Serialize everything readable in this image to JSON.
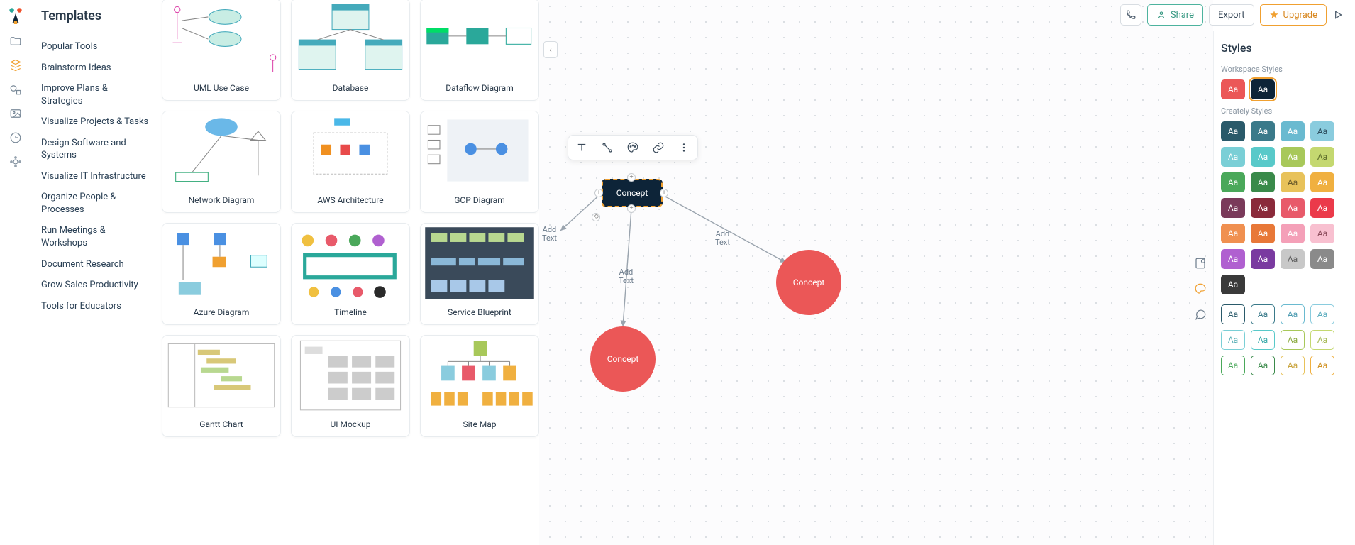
{
  "sidebar": {
    "title": "Templates",
    "categories": [
      "Popular Tools",
      "Brainstorm Ideas",
      "Improve Plans & Strategies",
      "Visualize Projects & Tasks",
      "Design Software and Systems",
      "Visualize IT Infrastructure",
      "Organize People & Processes",
      "Run Meetings & Workshops",
      "Document Research",
      "Grow Sales Productivity",
      "Tools for Educators"
    ]
  },
  "templates": [
    {
      "label": "UML Use Case"
    },
    {
      "label": "Database"
    },
    {
      "label": "Dataflow Diagram"
    },
    {
      "label": "Network Diagram"
    },
    {
      "label": "AWS Architecture"
    },
    {
      "label": "GCP Diagram"
    },
    {
      "label": "Azure Diagram"
    },
    {
      "label": "Timeline"
    },
    {
      "label": "Service Blueprint"
    },
    {
      "label": "Gantt Chart"
    },
    {
      "label": "UI Mockup"
    },
    {
      "label": "Site Map"
    }
  ],
  "canvas": {
    "collapse_glyph": "‹",
    "nodes": {
      "main": "Concept",
      "c1": "Concept",
      "c2": "Concept"
    },
    "hints": {
      "left": "Add\nText",
      "mid": "Add\nText",
      "right": "Add\nText"
    }
  },
  "styles_panel": {
    "title": "Styles",
    "group_workspace": "Workspace Styles",
    "group_creately": "Creately Styles",
    "swatch_label": "Aa",
    "workspace": [
      {
        "bg": "#eb5757",
        "fg": "#ffffff",
        "selected": false
      },
      {
        "bg": "#0d2438",
        "fg": "#ffffff",
        "selected": true
      }
    ],
    "creately_solid": [
      {
        "bg": "#2a5a6a",
        "fg": "#ffffff"
      },
      {
        "bg": "#3a7a8a",
        "fg": "#ffffff"
      },
      {
        "bg": "#6abad0",
        "fg": "#ffffff"
      },
      {
        "bg": "#8accde",
        "fg": "#2a4a5a"
      },
      {
        "bg": "#7acfd6",
        "fg": "#ffffff"
      },
      {
        "bg": "#58c9c9",
        "fg": "#ffffff"
      },
      {
        "bg": "#a8c85a",
        "fg": "#ffffff"
      },
      {
        "bg": "#c4d870",
        "fg": "#5a6a2a"
      },
      {
        "bg": "#4aa85a",
        "fg": "#ffffff"
      },
      {
        "bg": "#3a8a4a",
        "fg": "#ffffff"
      },
      {
        "bg": "#e8c25a",
        "fg": "#6a5a2a"
      },
      {
        "bg": "#f0b040",
        "fg": "#ffffff"
      },
      {
        "bg": "#7a3a5a",
        "fg": "#ffffff"
      },
      {
        "bg": "#8a2a3a",
        "fg": "#ffffff"
      },
      {
        "bg": "#e85a6a",
        "fg": "#ffffff"
      },
      {
        "bg": "#eb3a4a",
        "fg": "#ffffff"
      },
      {
        "bg": "#f09050",
        "fg": "#ffffff"
      },
      {
        "bg": "#e87838",
        "fg": "#ffffff"
      },
      {
        "bg": "#f4a0b8",
        "fg": "#ffffff"
      },
      {
        "bg": "#f8c0d0",
        "fg": "#8a4a5a"
      },
      {
        "bg": "#b060d0",
        "fg": "#ffffff"
      },
      {
        "bg": "#7a3aa0",
        "fg": "#ffffff"
      },
      {
        "bg": "#c8c8c8",
        "fg": "#5a5a5a"
      },
      {
        "bg": "#8a8a8a",
        "fg": "#ffffff"
      },
      {
        "bg": "#3a3a3a",
        "fg": "#ffffff"
      }
    ],
    "creately_outline": [
      {
        "border": "#2a5a6a",
        "fg": "#2a5a6a"
      },
      {
        "border": "#3a7a8a",
        "fg": "#3a7a8a"
      },
      {
        "border": "#6abad0",
        "fg": "#4a9ab0"
      },
      {
        "border": "#8accde",
        "fg": "#5aacbe"
      },
      {
        "border": "#7acfd6",
        "fg": "#5aafb6"
      },
      {
        "border": "#58c9c9",
        "fg": "#38a9a9"
      },
      {
        "border": "#a8c85a",
        "fg": "#88a83a"
      },
      {
        "border": "#c4d870",
        "fg": "#a4b850"
      },
      {
        "border": "#4aa85a",
        "fg": "#4aa85a"
      },
      {
        "border": "#3a8a4a",
        "fg": "#3a8a4a"
      },
      {
        "border": "#e8c25a",
        "fg": "#c8a23a"
      },
      {
        "border": "#f0b040",
        "fg": "#d09020"
      }
    ]
  },
  "top": {
    "share": "Share",
    "export": "Export",
    "upgrade": "Upgrade"
  }
}
